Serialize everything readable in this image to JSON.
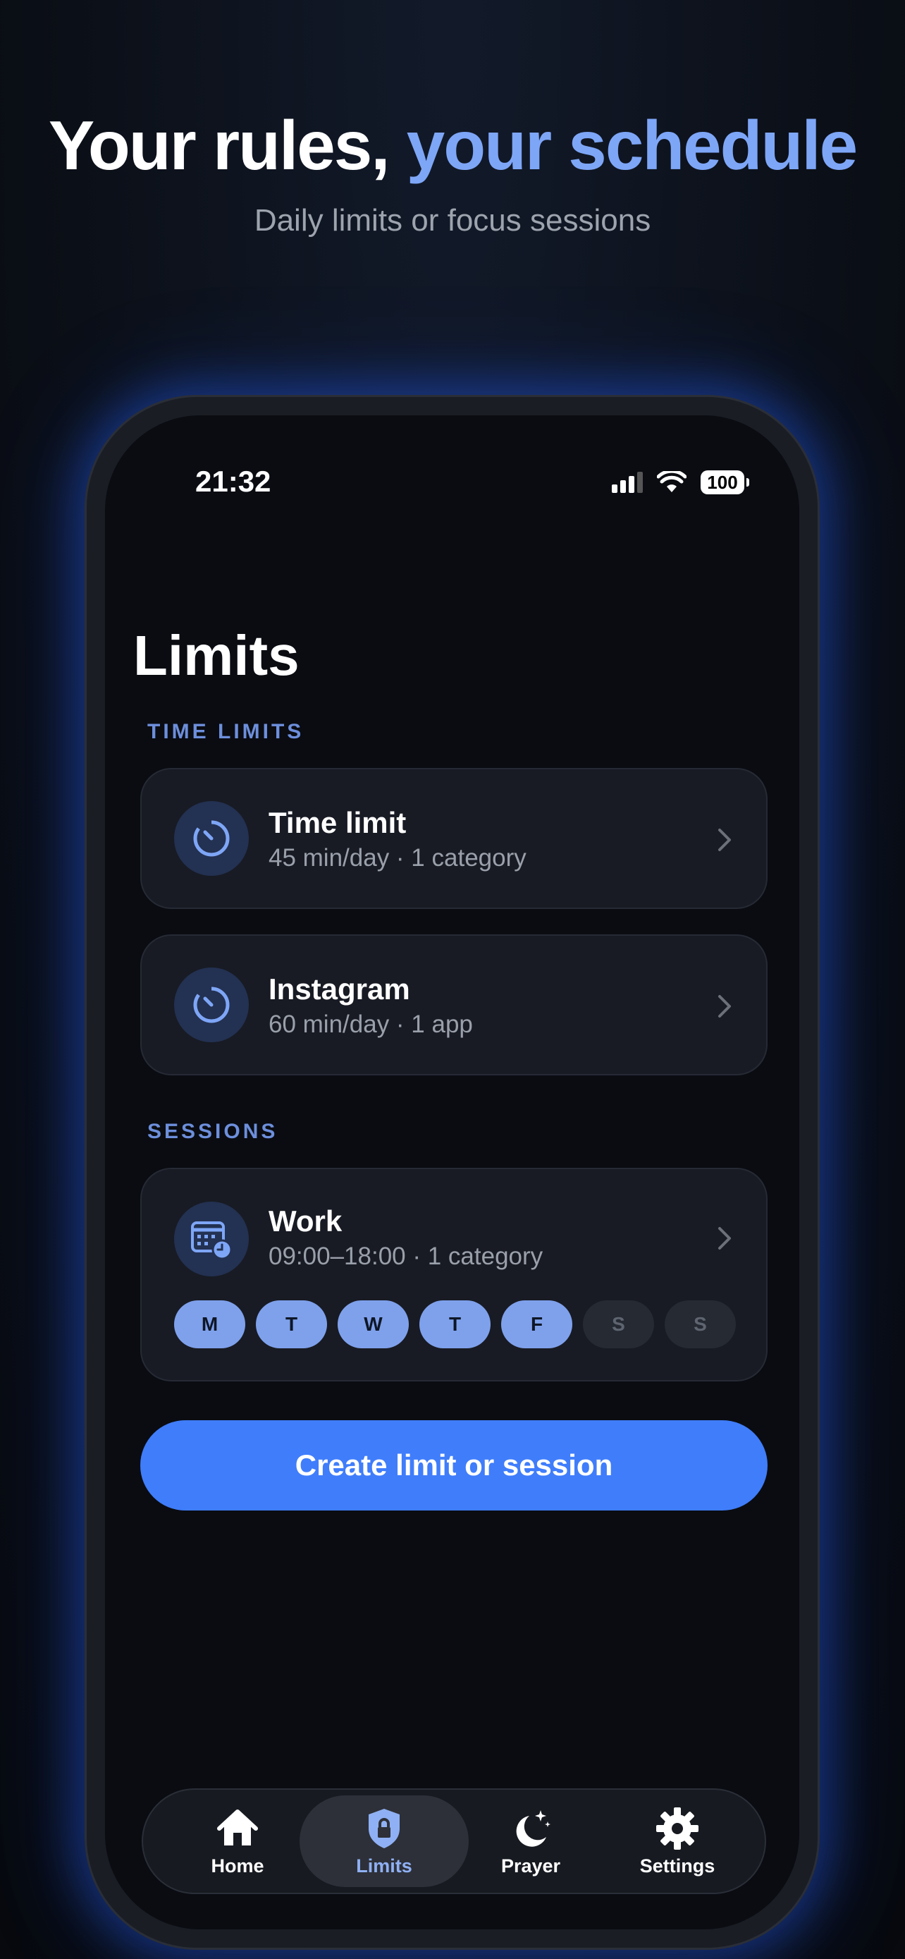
{
  "hero": {
    "title_white": "Your rules, ",
    "title_accent": "your schedule",
    "subtitle": "Daily limits or focus sessions"
  },
  "status_bar": {
    "time": "21:32",
    "battery": "100"
  },
  "page": {
    "title": "Limits"
  },
  "sections": {
    "time_limits_label": "TIME LIMITS",
    "sessions_label": "SESSIONS"
  },
  "time_limits": [
    {
      "title": "Time limit",
      "subtitle": "45 min/day · 1 category",
      "icon": "timer-icon"
    },
    {
      "title": "Instagram",
      "subtitle": "60 min/day · 1 app",
      "icon": "timer-icon"
    }
  ],
  "sessions": [
    {
      "title": "Work",
      "subtitle": "09:00–18:00 · 1 category",
      "icon": "calendar-clock-icon",
      "days": [
        {
          "label": "M",
          "active": true
        },
        {
          "label": "T",
          "active": true
        },
        {
          "label": "W",
          "active": true
        },
        {
          "label": "T",
          "active": true
        },
        {
          "label": "F",
          "active": true
        },
        {
          "label": "S",
          "active": false
        },
        {
          "label": "S",
          "active": false
        }
      ]
    }
  ],
  "cta": {
    "label": "Create limit or session"
  },
  "tabs": [
    {
      "label": "Home",
      "icon": "home-icon",
      "active": false
    },
    {
      "label": "Limits",
      "icon": "shield-lock-icon",
      "active": true
    },
    {
      "label": "Prayer",
      "icon": "moon-stars-icon",
      "active": false
    },
    {
      "label": "Settings",
      "icon": "gear-icon",
      "active": false
    }
  ],
  "colors": {
    "accent": "#7ea6f7",
    "primary_button": "#3f7dfb",
    "background": "#0a0c12",
    "card": "#181b24"
  }
}
